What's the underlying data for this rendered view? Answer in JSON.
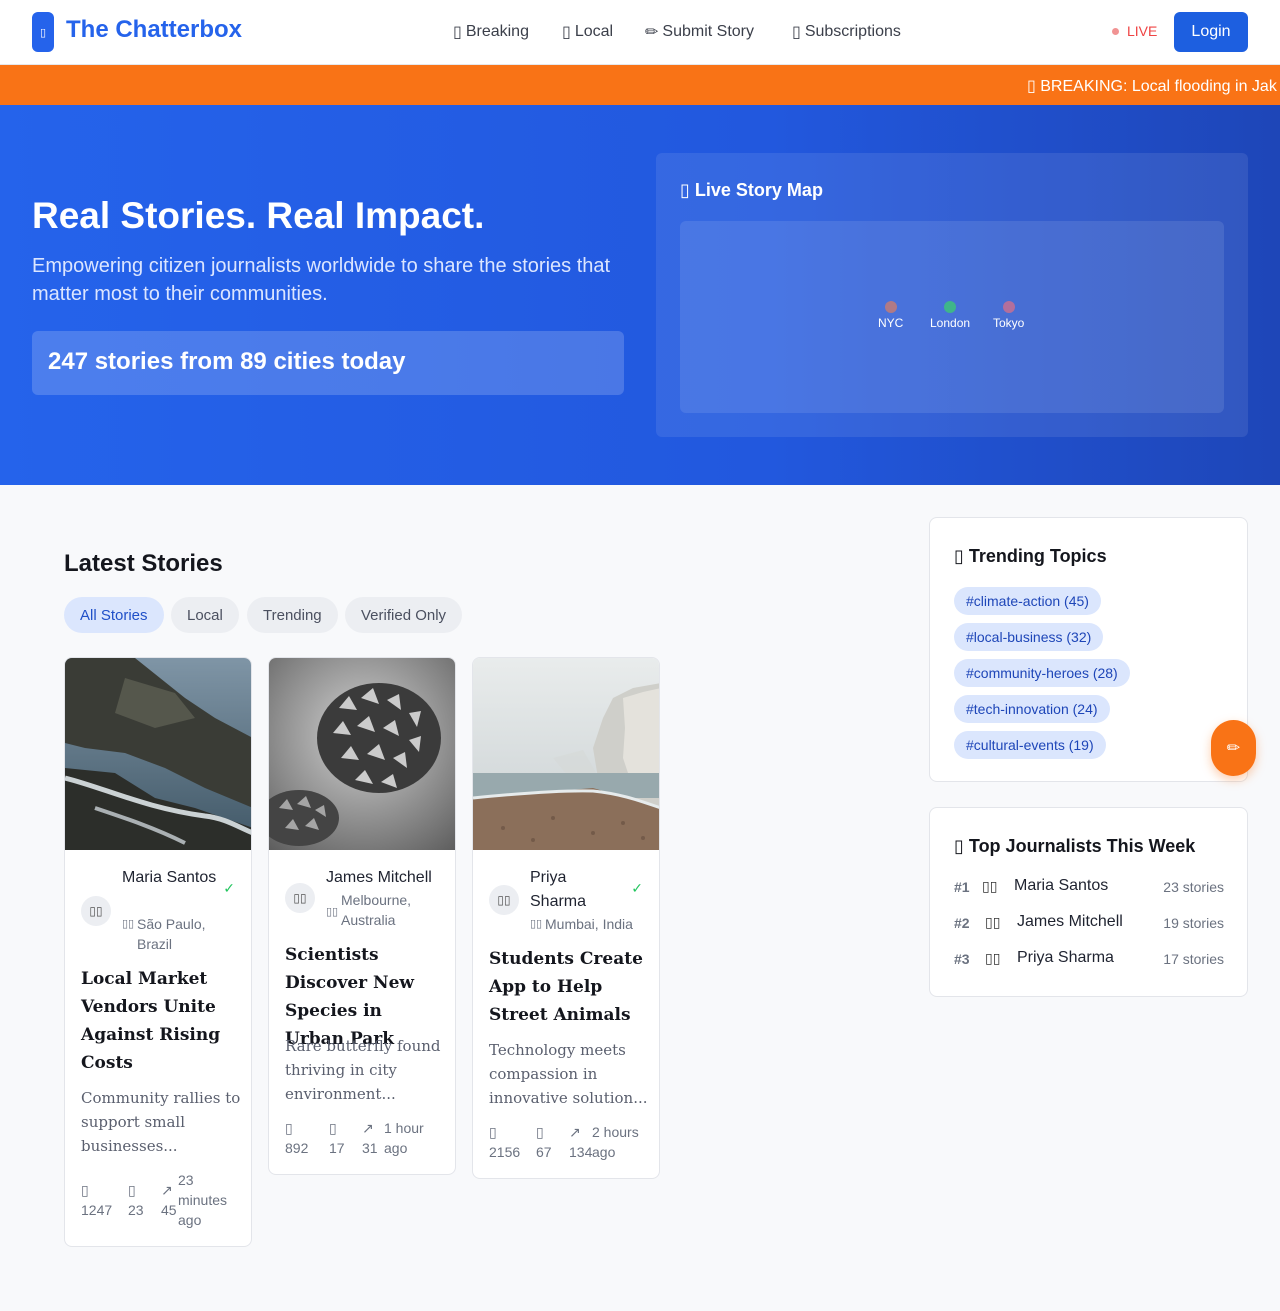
{
  "header": {
    "logo_icon": "▯",
    "logo_text": "The Chatterbox",
    "nav": [
      {
        "icon": "▯",
        "label": "Breaking"
      },
      {
        "icon": "▯",
        "label": "Local"
      },
      {
        "icon": "✏",
        "label": "Submit Story"
      },
      {
        "icon": "▯",
        "label": "Subscriptions"
      }
    ],
    "live_label": "LIVE",
    "login_label": "Login"
  },
  "ticker": {
    "text": "▯ BREAKING: Local flooding in Jak"
  },
  "hero": {
    "title": "Real Stories. Real Impact.",
    "subtitle": "Empowering citizen journalists worldwide to share the stories that matter most to their communities.",
    "stat": "247 stories from 89 cities today",
    "map": {
      "title": "▯ Live Story Map",
      "pins": [
        {
          "label": "NYC",
          "color": "#b07a86"
        },
        {
          "label": "London",
          "color": "#3fb58a"
        },
        {
          "label": "Tokyo",
          "color": "#b36f9c"
        }
      ]
    }
  },
  "latest": {
    "title": "Latest Stories",
    "filters": [
      "All Stories",
      "Local",
      "Trending",
      "Verified Only"
    ],
    "stories": [
      {
        "author": "Maria Santos",
        "location": "São Paulo, Brazil",
        "loc_icon": "▯▯",
        "avatar": "▯▯",
        "verified": "✓",
        "title": "Local Market Vendors Unite Against Rising Costs",
        "desc": "Community rallies to support small businesses...",
        "views": "1247",
        "comments": "23",
        "shares": "45",
        "time": "23 minutes ago"
      },
      {
        "author": "James Mitchell",
        "location": "Melbourne, Australia",
        "loc_icon": "▯▯",
        "avatar": "▯▯",
        "verified": "",
        "title": "Scientists Discover New Species in Urban Park",
        "desc": "Rare butterfly found thriving in city environment...",
        "views": "892",
        "comments": "17",
        "shares": "31",
        "time": "1 hour ago"
      },
      {
        "author": "Priya Sharma",
        "location": "Mumbai, India",
        "loc_icon": "▯▯",
        "avatar": "▯▯",
        "verified": "✓",
        "title": "Students Create App to Help Street Animals",
        "desc": "Technology meets compassion in innovative solution...",
        "views": "2156",
        "comments": "67",
        "shares": "134",
        "time": "2 hours ago"
      }
    ],
    "stat_icons": {
      "views": "▯",
      "comments": "▯",
      "shares": "↗"
    }
  },
  "trending": {
    "title": "▯ Trending Topics",
    "tags": [
      "#climate-action (45)",
      "#local-business (32)",
      "#community-heroes (28)",
      "#tech-innovation (24)",
      "#cultural-events (19)"
    ]
  },
  "journalists": {
    "title": "▯ Top Journalists This Week",
    "rows": [
      {
        "rank": "#1",
        "avatar": "▯▯",
        "name": "Maria Santos",
        "count": "23 stories"
      },
      {
        "rank": "#2",
        "avatar": "▯▯",
        "name": "James Mitchell",
        "count": "19 stories"
      },
      {
        "rank": "#3",
        "avatar": "▯▯",
        "name": "Priya Sharma",
        "count": "17 stories"
      }
    ]
  },
  "fab_icon": "✏",
  "colors": {
    "brand": "#2563eb",
    "accent": "#f97316",
    "verified": "#22c55e",
    "live": "#ef4444"
  }
}
